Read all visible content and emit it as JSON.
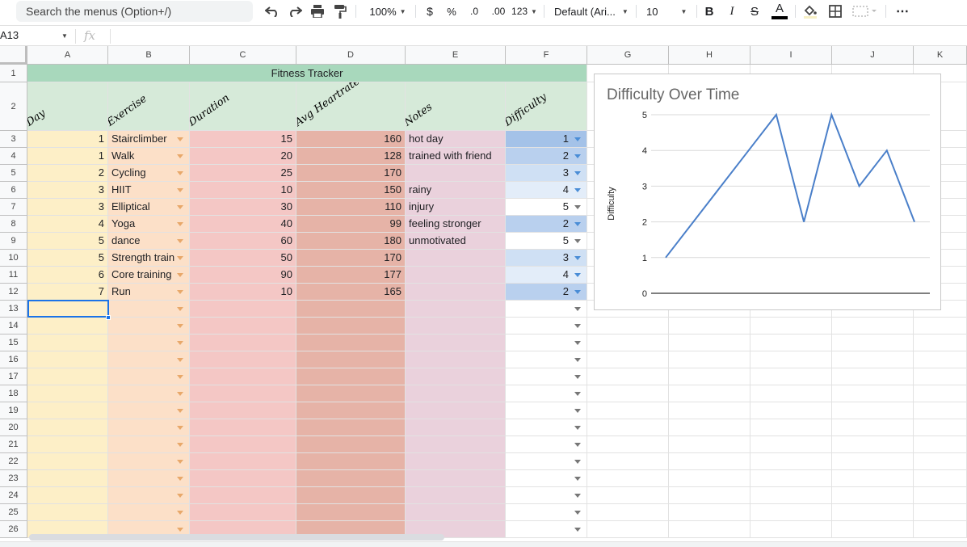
{
  "toolbar": {
    "search_placeholder": "Search the menus (Option+/)",
    "zoom": "100%",
    "currency": "$",
    "percent": "%",
    "dec_decrease": ".0",
    "dec_increase": ".00",
    "more_formats": "123",
    "font": "Default (Ari...",
    "font_size": "10",
    "bold": "B",
    "italic": "I",
    "strike": "S",
    "text_color": "A",
    "more": "⋯"
  },
  "formula_bar": {
    "name_box": "A13",
    "fx": "fx",
    "value": ""
  },
  "columns": [
    "A",
    "B",
    "C",
    "D",
    "E",
    "F",
    "G",
    "H",
    "I",
    "J",
    "K"
  ],
  "rows": [
    "1",
    "2",
    "3",
    "4",
    "5",
    "6",
    "7",
    "8",
    "9",
    "10",
    "11",
    "12",
    "13",
    "14",
    "15",
    "16",
    "17",
    "18",
    "19",
    "20",
    "21",
    "22",
    "23",
    "24",
    "25",
    "26"
  ],
  "sheet": {
    "title": "Fitness Tracker",
    "headers": [
      "Day",
      "Exercise",
      "Duration",
      "Avg Heartrate",
      "Notes",
      "Difficulty"
    ],
    "data": [
      {
        "day": "1",
        "exercise": "Stairclimber",
        "duration": "15",
        "heartrate": "160",
        "notes": "hot day",
        "difficulty": "1"
      },
      {
        "day": "1",
        "exercise": "Walk",
        "duration": "20",
        "heartrate": "128",
        "notes": "trained with friend",
        "difficulty": "2"
      },
      {
        "day": "2",
        "exercise": "Cycling",
        "duration": "25",
        "heartrate": "170",
        "notes": "",
        "difficulty": "3"
      },
      {
        "day": "3",
        "exercise": "HIIT",
        "duration": "10",
        "heartrate": "150",
        "notes": "rainy",
        "difficulty": "4"
      },
      {
        "day": "3",
        "exercise": "Elliptical",
        "duration": "30",
        "heartrate": "110",
        "notes": "injury",
        "difficulty": "5"
      },
      {
        "day": "4",
        "exercise": "Yoga",
        "duration": "40",
        "heartrate": "99",
        "notes": "feeling stronger",
        "difficulty": "2"
      },
      {
        "day": "5",
        "exercise": "dance",
        "duration": "60",
        "heartrate": "180",
        "notes": "unmotivated",
        "difficulty": "5"
      },
      {
        "day": "5",
        "exercise": "Strength train",
        "duration": "50",
        "heartrate": "170",
        "notes": "",
        "difficulty": "3"
      },
      {
        "day": "6",
        "exercise": "Core training",
        "duration": "90",
        "heartrate": "177",
        "notes": "",
        "difficulty": "4"
      },
      {
        "day": "7",
        "exercise": "Run",
        "duration": "10",
        "heartrate": "165",
        "notes": "",
        "difficulty": "2"
      }
    ],
    "colors": {
      "title_bg": "#a8d8bc",
      "header_bg": "#d6ead9",
      "day_bg": "#fdefc7",
      "exercise_bg": "#fce0c8",
      "duration_bg": "#f4c7c5",
      "heartrate_bg": "#e6b3a7",
      "notes_bg": "#ead1dc",
      "difficulty_bg": {
        "1": "#a4c2e8",
        "2": "#b9d0ee",
        "3": "#cfe0f4",
        "4": "#e3edf9",
        "5": "#ffffff"
      }
    }
  },
  "chart_data": {
    "type": "line",
    "title": "Difficulty Over Time",
    "ylabel": "Difficulty",
    "xlabel": "",
    "ylim": [
      0,
      5
    ],
    "yticks": [
      "0",
      "1",
      "2",
      "3",
      "4",
      "5"
    ],
    "values": [
      1,
      2,
      3,
      4,
      5,
      2,
      5,
      3,
      4,
      2
    ],
    "grid": true,
    "line_color": "#4a7fc9"
  }
}
